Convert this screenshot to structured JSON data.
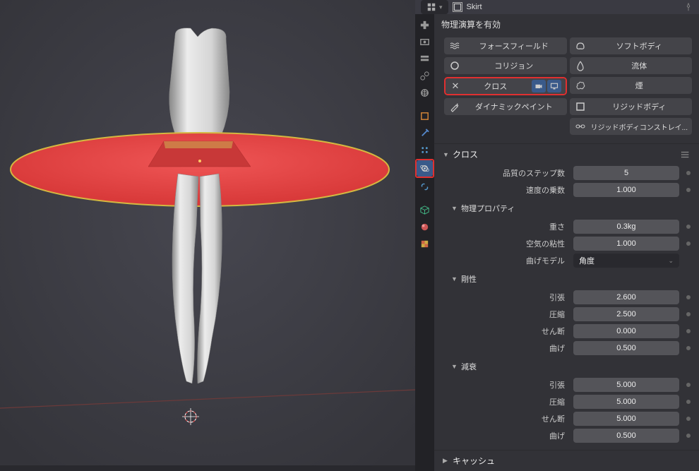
{
  "object_name": "Skirt",
  "physics_section": "物理演算を有効",
  "physics_buttons": {
    "forcefield": "フォースフィールド",
    "softbody": "ソフトボディ",
    "collision": "コリジョン",
    "fluid": "流体",
    "cloth": "クロス",
    "smoke": "煙",
    "dynamic_paint": "ダイナミックペイント",
    "rigid_body": "リジッドボディ",
    "rigid_constraint": "リジッドボディコンストレイ..."
  },
  "cloth_panel": {
    "title": "クロス",
    "quality_steps_label": "品質のステップ数",
    "quality_steps_value": "5",
    "speed_multiplier_label": "速度の乗数",
    "speed_multiplier_value": "1.000"
  },
  "physical_props": {
    "title": "物理プロパティ",
    "mass_label": "重さ",
    "mass_value": "0.3kg",
    "air_viscosity_label": "空気の粘性",
    "air_viscosity_value": "1.000",
    "bending_model_label": "曲げモデル",
    "bending_model_value": "角度"
  },
  "stiffness": {
    "title": "剛性",
    "tension_label": "引張",
    "tension_value": "2.600",
    "compression_label": "圧縮",
    "compression_value": "2.500",
    "shear_label": "せん断",
    "shear_value": "0.000",
    "bending_label": "曲げ",
    "bending_value": "0.500"
  },
  "damping": {
    "title": "減衰",
    "tension_label": "引張",
    "tension_value": "5.000",
    "compression_label": "圧縮",
    "compression_value": "5.000",
    "shear_label": "せん断",
    "shear_value": "5.000",
    "bending_label": "曲げ",
    "bending_value": "0.500"
  },
  "cache": {
    "title": "キャッシュ"
  },
  "chart_data": null
}
